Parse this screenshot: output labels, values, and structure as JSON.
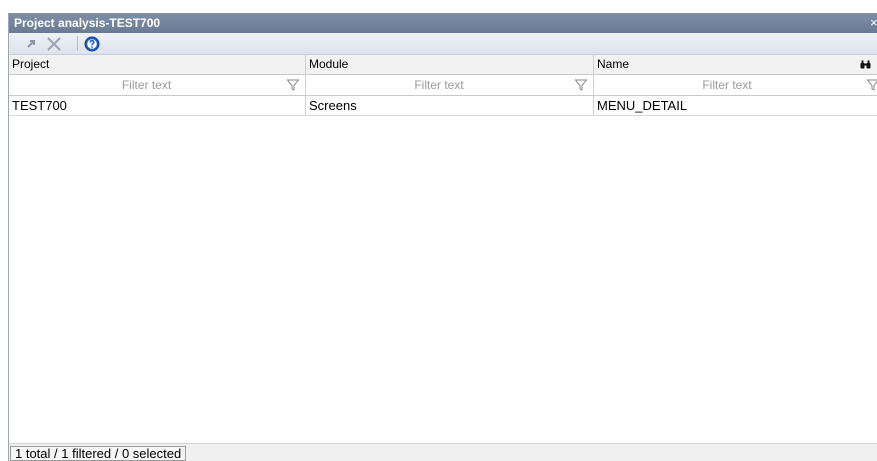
{
  "window": {
    "title": "Project analysis-TEST700",
    "close_glyph": "×"
  },
  "toolbar": {
    "items": [
      {
        "icon": "refresh-arrow-icon",
        "color": "#8a96a8"
      },
      {
        "icon": "close-icon",
        "color": "#9aa3b0"
      },
      {
        "icon": "help-icon",
        "color": "#1e5fc9"
      }
    ]
  },
  "grid": {
    "columns": [
      "Project",
      "Module",
      "Name"
    ],
    "filter_placeholder": "Filter text",
    "rows": [
      {
        "project": "TEST700",
        "module": "Screens",
        "name": "MENU_DETAIL"
      }
    ]
  },
  "status": {
    "text": "1 total / 1 filtered / 0 selected"
  }
}
